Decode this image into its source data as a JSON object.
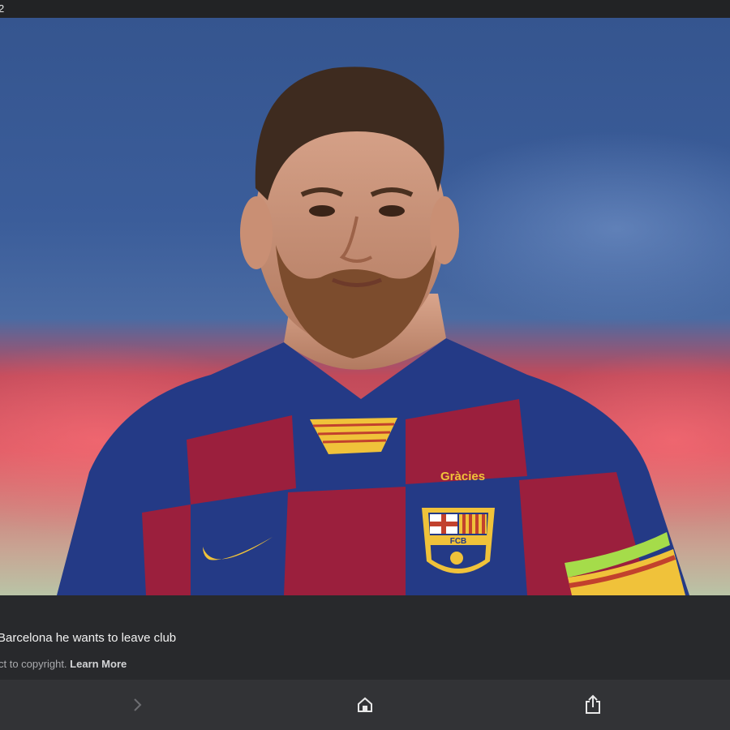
{
  "topbar": {
    "counter": "2"
  },
  "photo": {
    "jersey_text": "Gràcies",
    "crest_text": "FCB"
  },
  "caption": {
    "title": "Barcelona he wants to leave club",
    "note_prefix": "ct to copyright.",
    "learn_more": "Learn More"
  },
  "toolbar": {
    "icons": [
      "chevron-right-icon",
      "home-icon",
      "share-icon"
    ]
  },
  "colors": {
    "background": "#2a2b2e",
    "toolbar": "#323336",
    "jersey_blue": "#243a86",
    "jersey_red": "#9b1f3d",
    "accent_yellow": "#f0c23a"
  }
}
